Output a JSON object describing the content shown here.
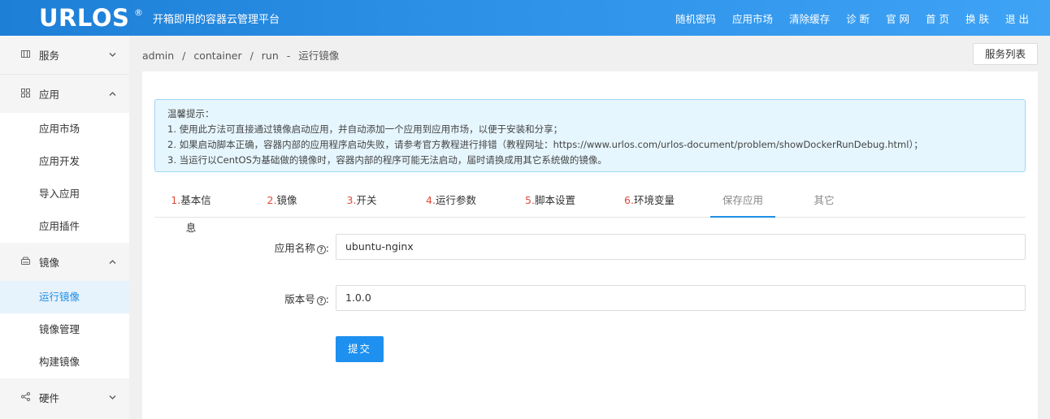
{
  "header": {
    "logo": "URLOS",
    "logo_mark": "®",
    "slogan": "开箱即用的容器云管理平台",
    "nav": [
      "随机密码",
      "应用市场",
      "清除缓存",
      "诊 断",
      "官 网",
      "首 页",
      "换 肤",
      "退 出"
    ]
  },
  "sidebar": {
    "groups": [
      {
        "label": "服务",
        "icon": "service-icon",
        "caret": "chevron-down-icon"
      },
      {
        "label": "应用",
        "icon": "apps-icon",
        "caret": "chevron-up-icon",
        "items": [
          "应用市场",
          "应用开发",
          "导入应用",
          "应用插件"
        ]
      },
      {
        "label": "镜像",
        "icon": "image-drive-icon",
        "caret": "chevron-up-icon",
        "items": [
          "运行镜像",
          "镜像管理",
          "构建镜像"
        ],
        "active_item": "运行镜像"
      },
      {
        "label": "硬件",
        "icon": "share-nodes-icon",
        "caret": "chevron-down-icon"
      }
    ]
  },
  "breadcrumb": [
    "admin",
    "/",
    "container",
    "/",
    "run",
    "-",
    "运行镜像"
  ],
  "service_list_button": "服务列表",
  "tip": {
    "title": "温馨提示：",
    "lines": [
      "1. 使用此方法可直接通过镜像启动应用，并自动添加一个应用到应用市场，以便于安装和分享；",
      "2. 如果启动脚本正确，容器内部的应用程序启动失败，请参考官方教程进行排错（教程网址：https://www.urlos.com/urlos-document/problem/showDockerRunDebug.html）；",
      "3. 当运行以CentOS为基础做的镜像时，容器内部的程序可能无法启动，届时请换成用其它系统做的镜像。"
    ]
  },
  "tabs": [
    {
      "num": "1.",
      "label": "基本信息"
    },
    {
      "num": "2.",
      "label": "镜像"
    },
    {
      "num": "3.",
      "label": "开关"
    },
    {
      "num": "4.",
      "label": "运行参数"
    },
    {
      "num": "5.",
      "label": "脚本设置"
    },
    {
      "num": "6.",
      "label": "环境变量"
    },
    {
      "num": "",
      "label": "保存应用"
    },
    {
      "num": "",
      "label": "其它"
    }
  ],
  "active_tab": "保存应用",
  "form": {
    "app_name_label": "应用名称",
    "app_name_value": "ubuntu-nginx",
    "version_label": "版本号",
    "version_value": "1.0.0",
    "help_glyph": "?",
    "label_suffix": ":",
    "submit_label": "提交"
  },
  "colors": {
    "accent": "#1e90f0",
    "header": "#2b8fe6",
    "tab_number": "#e04a3a",
    "tip_bg": "#e6f6fe"
  }
}
